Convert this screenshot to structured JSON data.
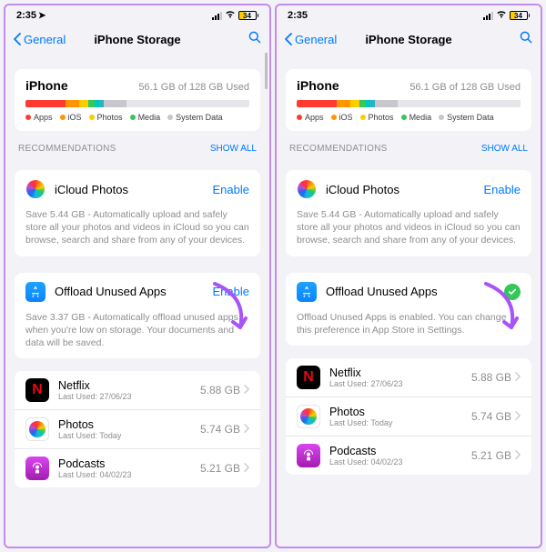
{
  "statusbar": {
    "time": "2:35",
    "battery_pct": "34"
  },
  "nav": {
    "back": "General",
    "title": "iPhone Storage"
  },
  "storage": {
    "device": "iPhone",
    "used_text": "56.1 GB of 128 GB Used",
    "segments": [
      {
        "color": "#ff3b30",
        "pct": 18
      },
      {
        "color": "#ff9500",
        "pct": 6
      },
      {
        "color": "#ffcc00",
        "pct": 4
      },
      {
        "color": "#34c759",
        "pct": 3
      },
      {
        "color": "#00c7be",
        "pct": 2
      },
      {
        "color": "#30b0c7",
        "pct": 2
      },
      {
        "color": "#c7c7cc",
        "pct": 10
      }
    ],
    "legend": [
      {
        "color": "#ff3b30",
        "label": "Apps"
      },
      {
        "color": "#ff9500",
        "label": "iOS"
      },
      {
        "color": "#ffcc00",
        "label": "Photos"
      },
      {
        "color": "#34c759",
        "label": "Media"
      },
      {
        "color": "#c7c7cc",
        "label": "System Data"
      }
    ]
  },
  "recommendations": {
    "header": "RECOMMENDATIONS",
    "show_all": "SHOW ALL",
    "icloud": {
      "title": "iCloud Photos",
      "action": "Enable",
      "desc": "Save 5.44 GB - Automatically upload and safely store all your photos and videos in iCloud so you can browse, search and share from any of your devices."
    },
    "offload_left": {
      "title": "Offload Unused Apps",
      "action": "Enable",
      "desc": "Save 3.37 GB - Automatically offload unused apps when you're low on storage. Your documents and data will be saved."
    },
    "offload_right": {
      "title": "Offload Unused Apps",
      "desc": "Offload Unused Apps is enabled. You can change this preference in App Store in Settings."
    }
  },
  "apps": [
    {
      "name": "Netflix",
      "sub": "Last Used: 27/06/23",
      "size": "5.88 GB",
      "icon": "netflix"
    },
    {
      "name": "Photos",
      "sub": "Last Used: Today",
      "size": "5.74 GB",
      "icon": "photos"
    },
    {
      "name": "Podcasts",
      "sub": "Last Used: 04/02/23",
      "size": "5.21 GB",
      "icon": "podcasts"
    }
  ],
  "annotation_color": "#a855f7"
}
